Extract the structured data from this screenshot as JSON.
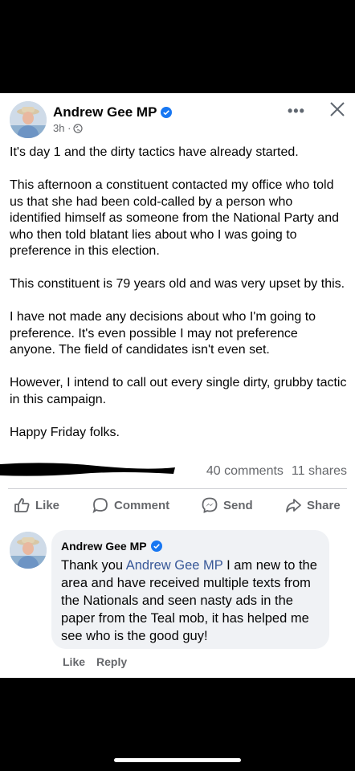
{
  "post": {
    "author": "Andrew Gee MP",
    "time": "3h ·",
    "icons": {
      "avatar": "profile-photo-icon",
      "verified": "verified-badge-icon",
      "privacy": "globe-icon",
      "more": "more-options-icon",
      "close": "close-icon"
    },
    "paragraphs": [
      "It's day 1 and the dirty tactics have already started.",
      "This afternoon a constituent contacted my office who told us that she had been cold-called by a person who identified himself as someone from the National Party and who then told blatant lies about who I was going to preference in this election.",
      "This constituent is 79 years old and was very upset by this.",
      "I have not made any decisions about who I'm going to preference. It's even possible I may not preference anyone. The field of candidates isn't even set.",
      "However, I intend to call out every single dirty, grubby tactic in this campaign.",
      "Happy Friday folks."
    ],
    "comments_count": "40 comments",
    "shares_count": "11 shares"
  },
  "actions": {
    "like": "Like",
    "comment": "Comment",
    "send": "Send",
    "share": "Share"
  },
  "comment": {
    "author": "Andrew Gee MP",
    "prefix": "Thank you ",
    "mention": "Andrew Gee MP",
    "text": " I am new to the area and have received multiple texts from the Nationals and seen nasty ads in the paper from the Teal mob, it has helped me see who is the good guy!",
    "like": "Like",
    "reply": "Reply"
  },
  "colors": {
    "link": "#385898",
    "meta": "#65676b",
    "verified": "#1877f2",
    "bubble": "#f0f2f5"
  }
}
